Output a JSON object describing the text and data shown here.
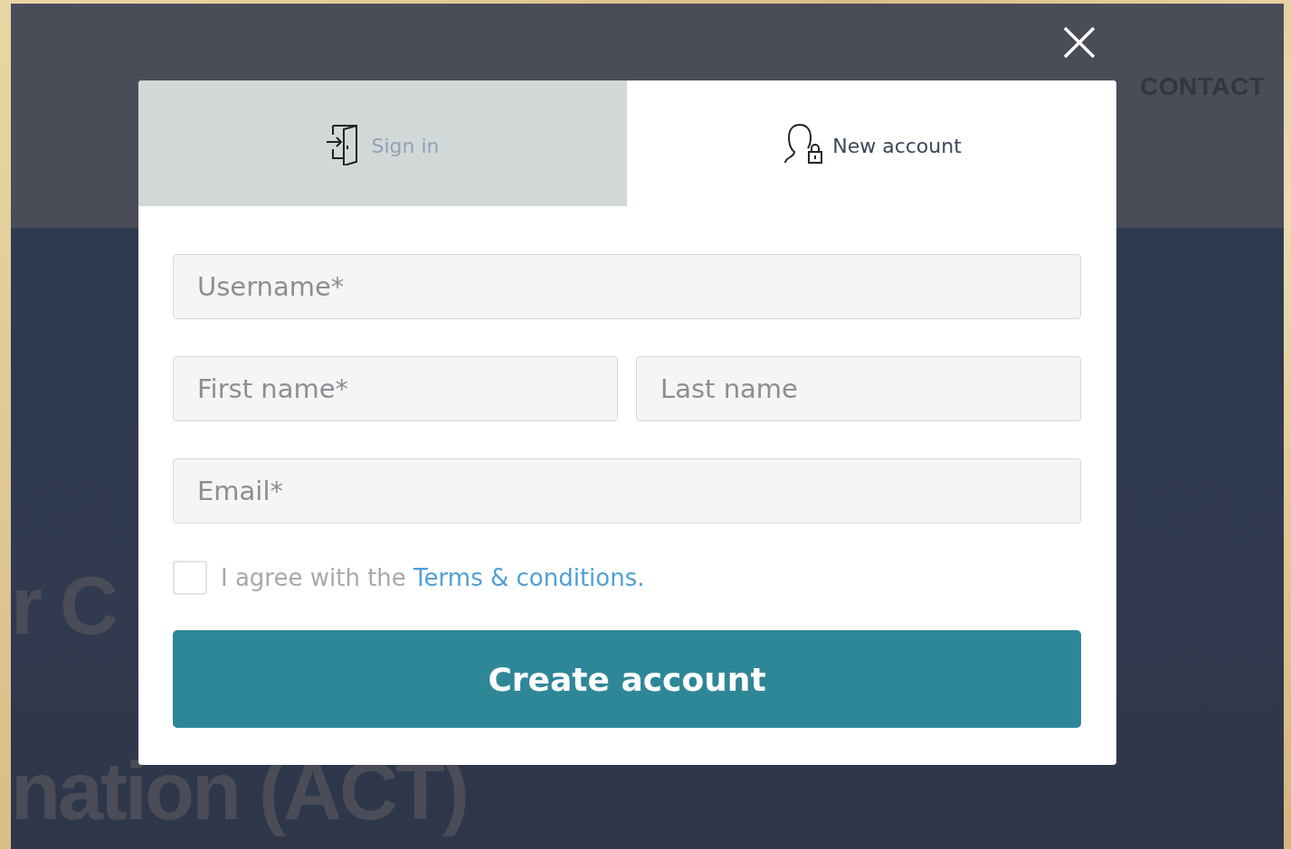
{
  "page": {
    "nav": [
      {
        "label": "CONTACT"
      }
    ],
    "hero": {
      "lines": [
        "r C",
        "nation (ACT)"
      ]
    }
  },
  "dialog": {
    "tabs": [
      {
        "label": "Sign in",
        "selected": false
      },
      {
        "label": "New account",
        "selected": true
      }
    ],
    "field_rows": [
      [
        {
          "placeholder": "Username*"
        }
      ],
      [
        {
          "placeholder": "First name*"
        },
        {
          "placeholder": "Last name"
        }
      ],
      [
        {
          "placeholder": "Email*"
        }
      ]
    ],
    "agreement": {
      "text": "I agree with the ",
      "link": "Terms & conditions.",
      "checked": false
    },
    "submit": "Create account"
  }
}
